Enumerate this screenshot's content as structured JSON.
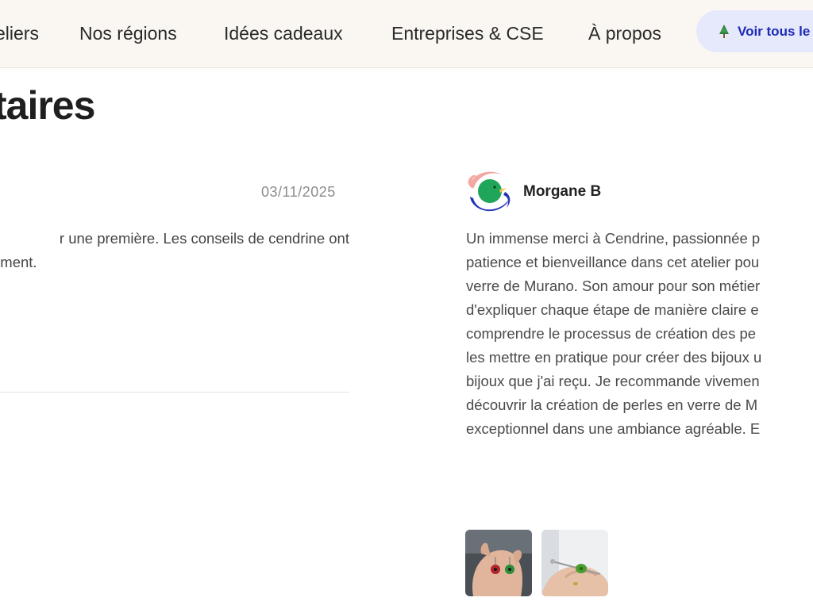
{
  "nav": {
    "items": [
      {
        "label": "eliers"
      },
      {
        "label": "Nos régions"
      },
      {
        "label": "Idées cadeaux"
      },
      {
        "label": "Entreprises & CSE"
      },
      {
        "label": "À propos"
      }
    ],
    "cta_label": "Voir tous le"
  },
  "page_title": "taires",
  "review_left": {
    "date": "03/11/2025",
    "lines": [
      "r une première. Les conseils de cendrine ont",
      "oment."
    ]
  },
  "review_right": {
    "author": "Morgane B",
    "lines": [
      "Un immense merci à Cendrine, passionnée p",
      "patience et bienveillance dans cet atelier pou",
      "verre de Murano. Son amour pour son métier",
      "d'expliquer chaque étape de manière claire e",
      "comprendre le processus de création des pe",
      "les mettre en pratique pour créer des bijoux u",
      "bijoux que j'ai reçu. Je recommande vivemen",
      "découvrir la création de perles en verre de M",
      "exceptionnel dans une ambiance agréable. E"
    ]
  },
  "colors": {
    "nav_bg": "#faf7f2",
    "cta_bg": "#e6e8fb",
    "cta_text": "#1d2ab8",
    "avatar_green": "#1fa65a",
    "avatar_blue": "#2433b5",
    "avatar_pink": "#f2a7a0"
  },
  "icons": [
    "christmas-tree-icon",
    "avatar-logo"
  ]
}
